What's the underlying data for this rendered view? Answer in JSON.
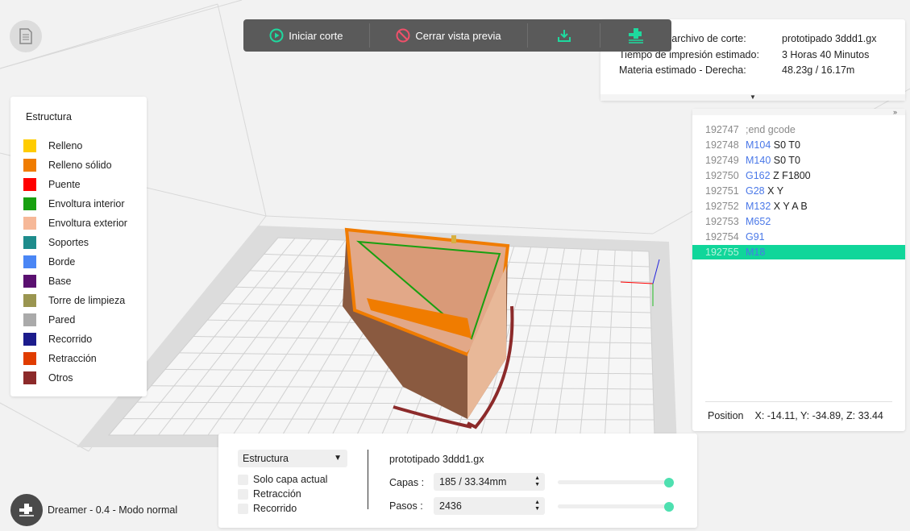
{
  "toolbar": {
    "start_slice": "Iniciar corte",
    "close_preview": "Cerrar vista previa",
    "icons": [
      "play-circle-icon",
      "prohibit-icon",
      "download-icon",
      "print-nozzle-icon"
    ]
  },
  "info": {
    "rows": [
      {
        "label": "Nombre de archivo de corte:",
        "value": "prototipado 3ddd1.gx"
      },
      {
        "label": "Tiempo de impresión estimado:",
        "value": "3 Horas 40 Minutos"
      },
      {
        "label": "Materia estimado - Derecha:",
        "value": "48.23g / 16.17m"
      }
    ]
  },
  "legend": {
    "title": "Estructura",
    "items": [
      {
        "label": "Relleno",
        "color": "#ffcc00"
      },
      {
        "label": "Relleno sólido",
        "color": "#f07c00"
      },
      {
        "label": "Puente",
        "color": "#ff0000"
      },
      {
        "label": "Envoltura interior",
        "color": "#18a010"
      },
      {
        "label": "Envoltura exterior",
        "color": "#f6b898"
      },
      {
        "label": "Soportes",
        "color": "#1e8c8c"
      },
      {
        "label": "Borde",
        "color": "#4a86f5"
      },
      {
        "label": "Base",
        "color": "#5a1070"
      },
      {
        "label": "Torre de limpieza",
        "color": "#9a9550"
      },
      {
        "label": "Pared",
        "color": "#aaaaaa"
      },
      {
        "label": "Recorrido",
        "color": "#1c1c8c"
      },
      {
        "label": "Retracción",
        "color": "#e03c00"
      },
      {
        "label": "Otros",
        "color": "#8c2a2a"
      }
    ]
  },
  "gcode": {
    "lines": [
      {
        "num": "192747",
        "cmd": ";end gcode",
        "args": "",
        "comment": true
      },
      {
        "num": "192748",
        "cmd": "M104",
        "args": "S0 T0"
      },
      {
        "num": "192749",
        "cmd": "M140",
        "args": "S0 T0"
      },
      {
        "num": "192750",
        "cmd": "G162",
        "args": "Z F1800"
      },
      {
        "num": "192751",
        "cmd": "G28",
        "args": "X Y"
      },
      {
        "num": "192752",
        "cmd": "M132",
        "args": "X Y A B"
      },
      {
        "num": "192753",
        "cmd": "M652",
        "args": ""
      },
      {
        "num": "192754",
        "cmd": "G91",
        "args": ""
      },
      {
        "num": "192755",
        "cmd": "M18",
        "args": "",
        "selected": true
      }
    ],
    "position_label": "Position",
    "position_value": "X: -14.11, Y: -34.89, Z: 33.44",
    "highlight_color": "#10d69a"
  },
  "bottom": {
    "view_select": "Estructura",
    "checkboxes": [
      {
        "label": "Solo capa actual",
        "checked": false
      },
      {
        "label": "Retracción",
        "checked": false
      },
      {
        "label": "Recorrido",
        "checked": false
      }
    ],
    "filename": "prototipado 3ddd1.gx",
    "layers_label": "Capas :",
    "layers_value": "185 / 33.34mm",
    "layers_slider_percent": 100,
    "steps_label": "Pasos :",
    "steps_value": "2436",
    "steps_slider_percent": 100
  },
  "printer": {
    "label": "Dreamer - 0.4 - Modo normal"
  }
}
